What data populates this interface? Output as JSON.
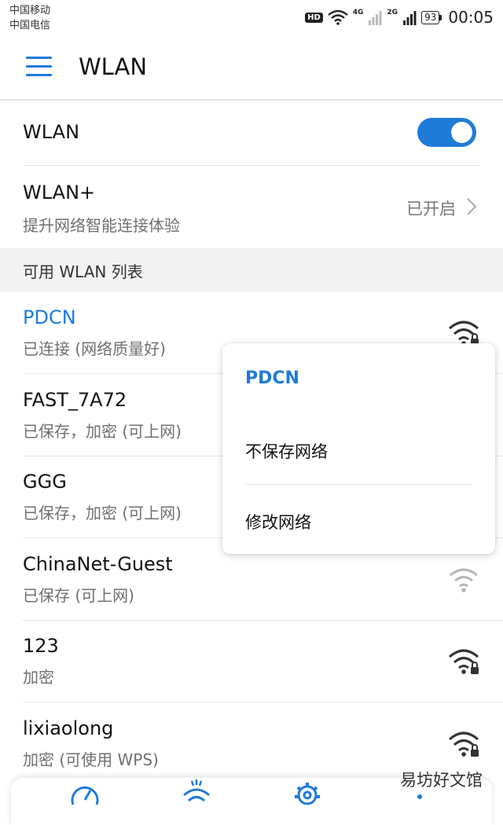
{
  "status_bar": {
    "carrier_1": "中国移动",
    "carrier_2": "中国电信",
    "hd": "HD",
    "net_1": "4G",
    "net_2": "2G",
    "battery": "93",
    "time": "00:05"
  },
  "app_bar": {
    "title": "WLAN",
    "menu_icon": "hamburger-menu-icon"
  },
  "wlan_toggle": {
    "label": "WLAN",
    "on": true
  },
  "wlan_plus": {
    "title": "WLAN+",
    "subtitle": "提升网络智能连接体验",
    "status": "已开启"
  },
  "section": {
    "title": "可用 WLAN 列表"
  },
  "networks": [
    {
      "name": "PDCN",
      "status": "已连接 (网络质量好)",
      "locked": true,
      "active": true
    },
    {
      "name": "FAST_7A72",
      "status": "已保存，加密 (可上网)",
      "locked": true,
      "active": false
    },
    {
      "name": "GGG",
      "status": "已保存，加密 (可上网)",
      "locked": true,
      "active": false
    },
    {
      "name": "ChinaNet-Guest",
      "status": "已保存 (可上网)",
      "locked": false,
      "active": false
    },
    {
      "name": "123",
      "status": "加密",
      "locked": true,
      "active": false
    },
    {
      "name": "lixiaolong",
      "status": "加密 (可使用 WPS)",
      "locked": true,
      "active": false
    }
  ],
  "popup": {
    "title": "PDCN",
    "items": [
      "不保存网络",
      "修改网络"
    ]
  },
  "watermark": "易坊好文馆",
  "colors": {
    "accent": "#1f7bd8",
    "secondary_text": "#6f6f6f"
  }
}
